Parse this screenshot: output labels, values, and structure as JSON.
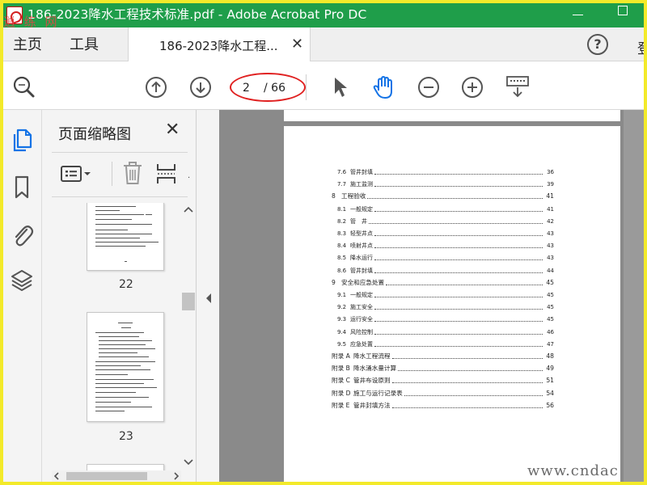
{
  "window": {
    "title": "186-2023降水工程技术标准.pdf - Adobe Acrobat Pro DC",
    "watermark_top": "逍 练 网",
    "watermark_bottom": "www.cndac"
  },
  "menu": {
    "home": "主页",
    "tools": "工具",
    "doc_tab": "186-2023降水工程...",
    "close_glyph": "✕",
    "help": "?",
    "signin": "登"
  },
  "toolbar": {
    "current_page": "2",
    "total_pages": "/ 66"
  },
  "panel": {
    "title": "页面缩略图",
    "close_glyph": "✕",
    "thumbnails": [
      {
        "label": "22"
      },
      {
        "label": "23"
      }
    ]
  },
  "toc": [
    {
      "num": "7.6",
      "title": "管井封填",
      "page": "36",
      "level": 2
    },
    {
      "num": "7.7",
      "title": "施工监测",
      "page": "39",
      "level": 2
    },
    {
      "num": "8",
      "title": "工程验收",
      "page": "41",
      "level": 1
    },
    {
      "num": "8.1",
      "title": "一般规定",
      "page": "41",
      "level": 2
    },
    {
      "num": "8.2",
      "title": "管　井",
      "page": "42",
      "level": 2
    },
    {
      "num": "8.3",
      "title": "轻型井点",
      "page": "43",
      "level": 2
    },
    {
      "num": "8.4",
      "title": "喷射井点",
      "page": "43",
      "level": 2
    },
    {
      "num": "8.5",
      "title": "降水运行",
      "page": "43",
      "level": 2
    },
    {
      "num": "8.6",
      "title": "管井封填",
      "page": "44",
      "level": 2
    },
    {
      "num": "9",
      "title": "安全和应急处置",
      "page": "45",
      "level": 1
    },
    {
      "num": "9.1",
      "title": "一般规定",
      "page": "45",
      "level": 2
    },
    {
      "num": "9.2",
      "title": "施工安全",
      "page": "45",
      "level": 2
    },
    {
      "num": "9.3",
      "title": "运行安全",
      "page": "45",
      "level": 2
    },
    {
      "num": "9.4",
      "title": "风险控制",
      "page": "46",
      "level": 2
    },
    {
      "num": "9.5",
      "title": "应急处置",
      "page": "47",
      "level": 2
    },
    {
      "num": "附录 A",
      "title": "降水工程流程",
      "page": "48",
      "level": 0
    },
    {
      "num": "附录 B",
      "title": "降水涌水量计算",
      "page": "49",
      "level": 0
    },
    {
      "num": "附录 C",
      "title": "管井布设原则",
      "page": "51",
      "level": 0
    },
    {
      "num": "附录 D",
      "title": "施工与运行记录表",
      "page": "54",
      "level": 0
    },
    {
      "num": "附录 E",
      "title": "管井封填方法",
      "page": "56",
      "level": 0
    }
  ],
  "colors": {
    "titlebar": "#1f9e4a",
    "accent_blue": "#1473e6",
    "annotation_red": "#e02020",
    "border_yellow": "#f3ea2a"
  },
  "icons": {
    "zoom": "magnifier-icon",
    "prev": "arrow-up-circle-icon",
    "next": "arrow-down-circle-icon",
    "select": "cursor-arrow-icon",
    "hand": "hand-icon",
    "zoom_out": "minus-circle-icon",
    "zoom_in": "plus-circle-icon",
    "keyboard": "keyboard-icon"
  }
}
